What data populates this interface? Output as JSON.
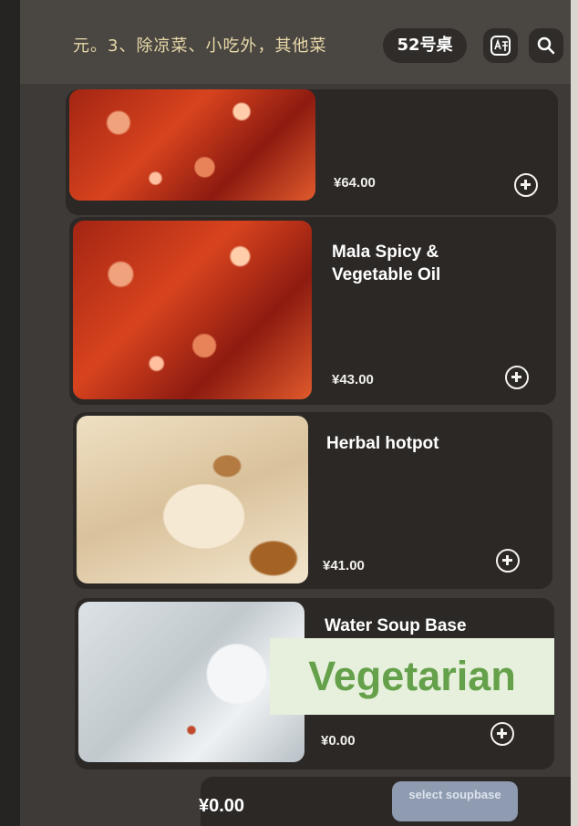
{
  "header": {
    "notice": "元。3、除凉菜、小吃外，其他菜",
    "table": "52号桌",
    "translate_icon": "translate-icon",
    "search_icon": "search-icon"
  },
  "menu": {
    "items": [
      {
        "name": "",
        "price": "¥64.00",
        "image": "red-oil-soup-photo"
      },
      {
        "name": "Mala Spicy & Vegetable Oil",
        "price": "¥43.00",
        "image": "mala-soup-photo"
      },
      {
        "name": "Herbal hotpot",
        "price": "¥41.00",
        "image": "herbal-soup-photo"
      },
      {
        "name": "Water Soup Base",
        "price": "¥0.00",
        "image": "water-soup-photo"
      }
    ],
    "add_icon": "plus-circle-icon"
  },
  "overlay": {
    "label": "Vegetarian"
  },
  "footer": {
    "total": "¥0.00",
    "select_button": "select soupbase"
  },
  "colors": {
    "screen_bg": "#3d3a37",
    "card_bg": "#2b2826",
    "notice_text": "#e8d9a8",
    "banner_bg": "#e6f0dc",
    "banner_text": "#65a14a",
    "button_bg": "#8f9bb0"
  }
}
